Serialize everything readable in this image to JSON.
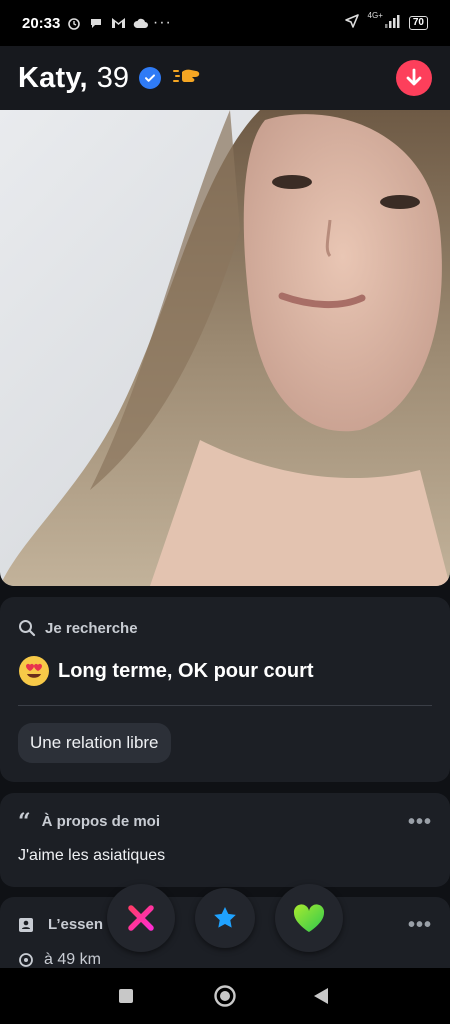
{
  "status_bar": {
    "time": "20:33",
    "network": "4G+",
    "battery": "70"
  },
  "profile": {
    "name": "Katy,",
    "age": "39"
  },
  "looking_for": {
    "label": "Je recherche",
    "value": "Long terme, OK pour court",
    "chip": "Une relation libre"
  },
  "about": {
    "label": "À propos de moi",
    "text": "J'aime les asiatiques"
  },
  "essentials": {
    "label": "L’essen",
    "distance": "à 49 km"
  },
  "colors": {
    "accent": "#fd3f5b",
    "nope": "#ff2d80",
    "super_like": "#1fa2ff",
    "like": "#56d12f",
    "verified": "#2f7bf6"
  },
  "icons": {
    "nope": "x-icon",
    "super_like": "star-icon",
    "like": "heart-icon",
    "collapse": "arrow-down-icon"
  }
}
